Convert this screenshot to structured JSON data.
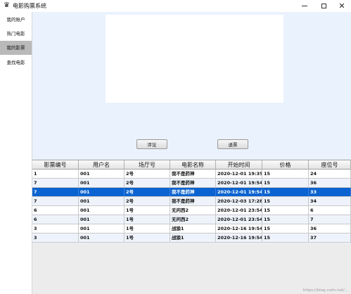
{
  "window": {
    "title": "电影购票系统",
    "icon": "app-icon",
    "controls": {
      "minimize": "–",
      "maximize": "□",
      "close": "×"
    }
  },
  "sidebar": {
    "items": [
      {
        "label": "我的账户",
        "active": false
      },
      {
        "label": "热门电影",
        "active": false
      },
      {
        "label": "我的影票",
        "active": true
      },
      {
        "label": "查找电影",
        "active": false
      }
    ]
  },
  "buttons": {
    "comment": "评论",
    "refund": "退票"
  },
  "table": {
    "columns": [
      "影票编号",
      "用户名",
      "场厅号",
      "电影名称",
      "开始时间",
      "价格",
      "座位号"
    ],
    "rows": [
      [
        "1",
        "001",
        "2号",
        "我不是药神",
        "2020-12-01 19:35:...",
        "15",
        "24"
      ],
      [
        "7",
        "001",
        "2号",
        "我不是药神",
        "2020-12-01 19:54:...",
        "15",
        "36"
      ],
      [
        "7",
        "001",
        "2号",
        "我不是药神",
        "2020-12-01 19:54:...",
        "15",
        "33"
      ],
      [
        "7",
        "001",
        "2号",
        "我不是药神",
        "2020-12-03 17:28:...",
        "15",
        "34"
      ],
      [
        "6",
        "001",
        "1号",
        "无问西2",
        "2020-12-01 23:54:...",
        "15",
        "6"
      ],
      [
        "6",
        "001",
        "1号",
        "无问西2",
        "2020-12-01 23:54:...",
        "15",
        "7"
      ],
      [
        "3",
        "001",
        "1号",
        "战狼1",
        "2020-12-16 19:54:...",
        "15",
        "36"
      ],
      [
        "3",
        "001",
        "1号",
        "战狼1",
        "2020-12-16 19:54:...",
        "15",
        "37"
      ]
    ],
    "selected_row": 2
  },
  "watermark": "https://blog.csdn.net/..."
}
